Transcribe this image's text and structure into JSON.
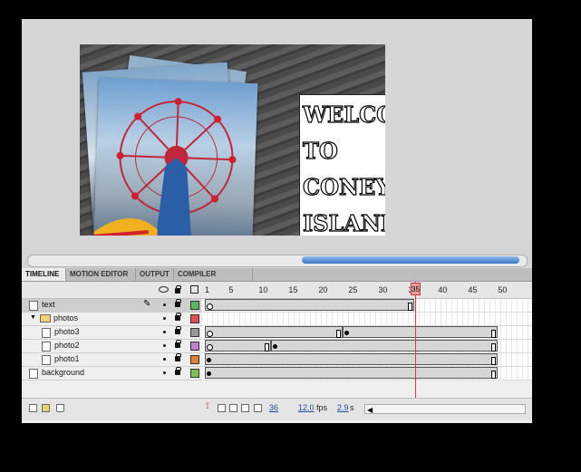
{
  "stage": {
    "headline": "WELCOME\nTO\nCONEY\nISLAND!"
  },
  "tabs": [
    "TIMELINE",
    "MOTION EDITOR",
    "OUTPUT",
    "COMPILER ERRORS"
  ],
  "frame_numbers": [
    "1",
    "5",
    "10",
    "15",
    "20",
    "25",
    "30",
    "35",
    "40",
    "45",
    "50"
  ],
  "layers": [
    {
      "name": "text",
      "color": "#5cb85c",
      "kind": "layer"
    },
    {
      "name": "photos",
      "color": "#e05050",
      "kind": "folder"
    },
    {
      "name": "photo3",
      "color": "#999999",
      "kind": "layer"
    },
    {
      "name": "photo2",
      "color": "#c080d0",
      "kind": "layer"
    },
    {
      "name": "photo1",
      "color": "#e08030",
      "kind": "layer"
    },
    {
      "name": "background",
      "color": "#7cc050",
      "kind": "layer"
    }
  ],
  "playhead": {
    "frame": "35"
  },
  "footer": {
    "current_frame": "36",
    "fps": "12.0",
    "fps_unit": "fps",
    "time": "2.9",
    "time_unit": "s"
  }
}
